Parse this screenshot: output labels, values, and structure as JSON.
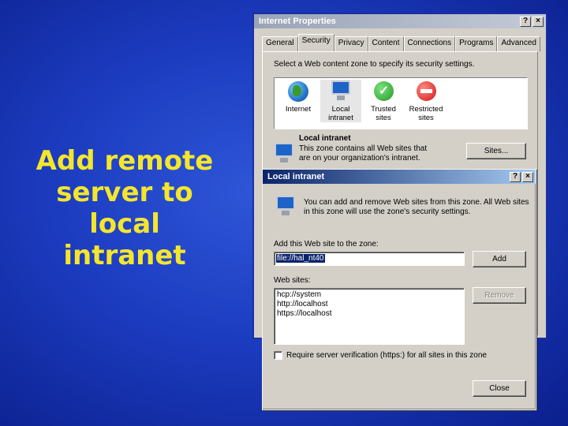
{
  "slide": {
    "title": "Add remote\nserver to\nlocal\nintranet"
  },
  "colors": {
    "slide_bg": "#1c3cc0",
    "title_text": "#f4e62c",
    "active_titlebar": "#0a246a"
  },
  "internet_properties": {
    "title": "Internet Properties",
    "help_btn": "?",
    "close_btn": "×",
    "tabs": [
      "General",
      "Security",
      "Privacy",
      "Content",
      "Connections",
      "Programs",
      "Advanced"
    ],
    "selected_tab": "Security",
    "instruction": "Select a Web content zone to specify its security settings.",
    "zones": [
      {
        "label": "Internet",
        "icon": "globe-icon"
      },
      {
        "label": "Local\nintranet",
        "icon": "intranet-monitor-icon"
      },
      {
        "label": "Trusted\nsites",
        "icon": "trusted-check-icon"
      },
      {
        "label": "Restricted\nsites",
        "icon": "restricted-stop-icon"
      }
    ],
    "zone_title": "Local intranet",
    "zone_desc": "This zone contains all Web sites that\nare on your organization's intranet.",
    "sites_button": "Sites..."
  },
  "local_intranet_dialog": {
    "title": "Local intranet",
    "help_btn": "?",
    "close_btn": "×",
    "info": "You can add and remove Web sites from this zone. All Web sites\nin this zone will use the zone's security settings.",
    "add_label": "Add this Web site to the zone:",
    "add_value": "file://hal_nt40",
    "add_button": "Add",
    "websites_label": "Web sites:",
    "websites": [
      "hcp://system",
      "http://localhost",
      "https://localhost"
    ],
    "remove_button": "Remove",
    "require_label": "Require server verification (https:) for all sites in this zone",
    "require_checked": false,
    "close_button": "Close"
  }
}
